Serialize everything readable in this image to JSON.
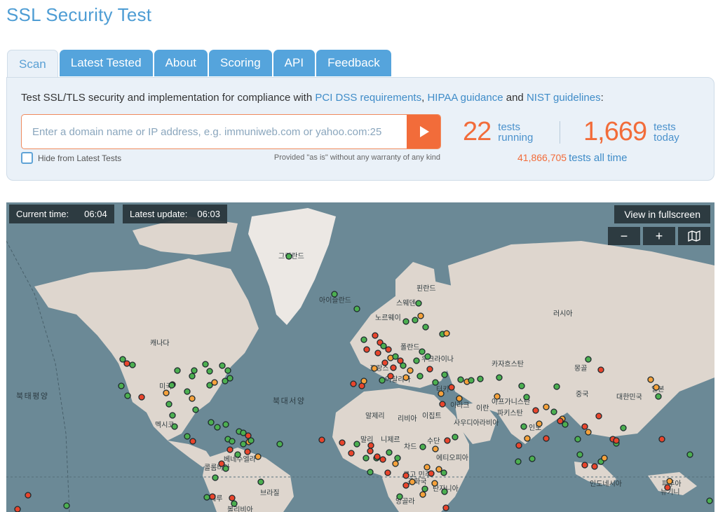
{
  "page_title": "SSL Security Test",
  "tabs": [
    {
      "label": "Scan",
      "active": true
    },
    {
      "label": "Latest Tested"
    },
    {
      "label": "About"
    },
    {
      "label": "Scoring"
    },
    {
      "label": "API"
    },
    {
      "label": "Feedback"
    }
  ],
  "intro": {
    "prefix": "Test SSL/TLS security and implementation for compliance with ",
    "link1": "PCI DSS requirements",
    "sep": ", ",
    "link2": "HIPAA guidance",
    "and": " and ",
    "link3": "NIST guidelines",
    "suffix": ":"
  },
  "search": {
    "placeholder": "Enter a domain name or IP address, e.g. immuniweb.com or yahoo.com:25",
    "value": "",
    "go_icon": "play-icon"
  },
  "hide_checkbox": {
    "label": "Hide from Latest Tests",
    "checked": false
  },
  "disclaimer": "Provided \"as is\" without any warranty of any kind",
  "stats": {
    "running": {
      "number": "22",
      "line1": "tests",
      "line2": "running"
    },
    "today": {
      "number": "1,669",
      "line1": "tests",
      "line2": "today"
    },
    "all_time": {
      "number": "41,866,705",
      "label": "tests all time"
    }
  },
  "map": {
    "current_time_label": "Current time:",
    "current_time": "06:04",
    "latest_update_label": "Latest update:",
    "latest_update": "06:03",
    "fullscreen_label": "View in fullscreen",
    "zoom_out": "−",
    "zoom_in": "+",
    "layers_icon": "map-icon",
    "labels": {
      "greenland": "그린란드",
      "iceland": "아이슬란드",
      "finland": "핀란드",
      "sweden": "스웨덴",
      "norway": "노르웨이",
      "russia": "러시아",
      "canada": "캐나다",
      "usa": "미국",
      "mexico": "멕시코",
      "north_pacific": "북태평양",
      "north_atlantic": "북대서양",
      "ukraine": "우크라이나",
      "france": "프랑스",
      "poland": "폴란드",
      "italy": "이탈리아",
      "kazakhstan": "카자흐스탄",
      "mongolia": "몽골",
      "china": "중국",
      "japan": "일본",
      "south_korea": "대한민국",
      "turkey": "터키",
      "iraq": "이라크",
      "iran": "이란",
      "afghanistan": "아프가니스탄",
      "pakistan": "파키스탄",
      "india": "인도",
      "algeria": "알제리",
      "libya": "리비아",
      "egypt": "이집트",
      "saudi_arabia": "사우디아라비아",
      "mali": "말리",
      "niger": "니제르",
      "chad": "차드",
      "sudan": "수단",
      "ethiopia": "에티오피아",
      "venezuela": "베네수엘라",
      "colombia": "콜롬비아",
      "brazil": "브라질",
      "peru": "페루",
      "bolivia": "볼리비아",
      "congo": "콩고 민주",
      "congo2": "공화국",
      "tanzania": "탄자니아",
      "angola": "앙골라",
      "indonesia": "인도네시아",
      "png": "파푸아",
      "png2": "뉴기니"
    }
  },
  "colors": {
    "accent_blue": "#4e9dd4",
    "accent_orange": "#f26c3a",
    "dot_green": "#4caf50",
    "dot_orange": "#f5a13b",
    "dot_red": "#e8452c",
    "ocean": "#6b8996",
    "land": "#ded6ce"
  }
}
